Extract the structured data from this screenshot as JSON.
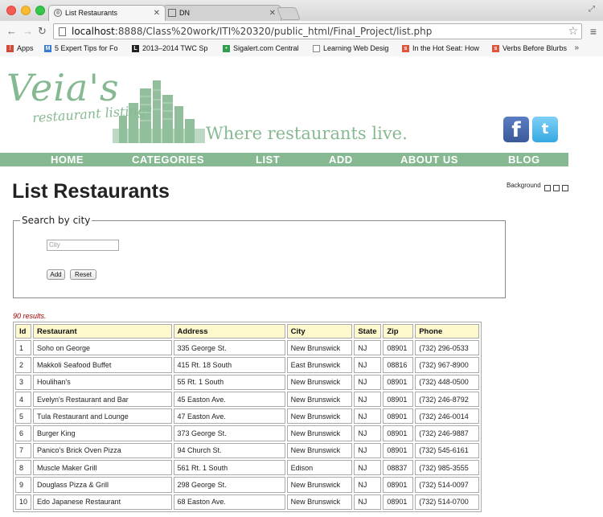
{
  "browser": {
    "tabs": [
      {
        "title": "List Restaurants",
        "active": true
      },
      {
        "title": "DN",
        "active": false
      }
    ],
    "url_host": "localhost",
    "url_rest": ":8888/Class%20work/ITI%20320/public_html/Final_Project/list.php",
    "bookmarks": [
      {
        "label": "Apps",
        "icon": "apps-grid-icon",
        "color": "#d44a3a"
      },
      {
        "label": "5 Expert Tips for Fo",
        "icon": "m-icon",
        "color": "#3a7bd5"
      },
      {
        "label": "2013–2014 TWC Sp",
        "icon": "l-icon",
        "color": "#222222"
      },
      {
        "label": "Sigalert.com Central",
        "icon": "traffic-icon",
        "color": "#2e9e4f"
      },
      {
        "label": "Learning Web Desig",
        "icon": "page-icon",
        "color": "#888888"
      },
      {
        "label": "In the Hot Seat: How",
        "icon": "bm-red-icon",
        "color": "#e0553b"
      },
      {
        "label": "Verbs Before Blurbs",
        "icon": "bm-red-icon",
        "color": "#e0553b"
      }
    ],
    "more": "»"
  },
  "site": {
    "logo": "Veia's",
    "logo_sub": "restaurant listings",
    "tagline": "Where restaurants live.",
    "nav": [
      "HOME",
      "CATEGORIES",
      "LIST",
      "ADD",
      "ABOUT US",
      "BLOG"
    ],
    "brand_color": "#86b992"
  },
  "page": {
    "title": "List Restaurants",
    "background_label": "Background",
    "search": {
      "legend": "Search by city",
      "placeholder": "City",
      "add_label": "Add",
      "reset_label": "Reset"
    },
    "results_text": "90 results."
  },
  "table": {
    "columns": [
      "Id",
      "Restaurant",
      "Address",
      "City",
      "State",
      "Zip",
      "Phone"
    ],
    "rows": [
      [
        "1",
        "Soho on George",
        "335 George St.",
        "New Brunswick",
        "NJ",
        "08901",
        "(732) 296-0533"
      ],
      [
        "2",
        "Makkoli Seafood Buffet",
        "415 Rt. 18 South",
        "East Brunswick",
        "NJ",
        "08816",
        "(732) 967-8900"
      ],
      [
        "3",
        "Houlihan's",
        "55 Rt. 1 South",
        "New Brunswick",
        "NJ",
        "08901",
        "(732) 448-0500"
      ],
      [
        "4",
        "Evelyn's Restaurant and Bar",
        "45 Easton Ave.",
        "New Brunswick",
        "NJ",
        "08901",
        "(732) 246-8792"
      ],
      [
        "5",
        "Tula Restaurant and Lounge",
        "47 Easton Ave.",
        "New Brunswick",
        "NJ",
        "08901",
        "(732) 246-0014"
      ],
      [
        "6",
        "Burger King",
        "373 George St.",
        "New Brunswick",
        "NJ",
        "08901",
        "(732) 246-9887"
      ],
      [
        "7",
        "Panico's Brick Oven Pizza",
        "94 Church St.",
        "New Brunswick",
        "NJ",
        "08901",
        "(732) 545-6161"
      ],
      [
        "8",
        "Muscle Maker Grill",
        "561 Rt. 1 South",
        "Edison",
        "NJ",
        "08837",
        "(732) 985-3555"
      ],
      [
        "9",
        "Douglass Pizza & Grill",
        "298 George St.",
        "New Brunswick",
        "NJ",
        "08901",
        "(732) 514-0097"
      ],
      [
        "10",
        "Edo Japanese Restaurant",
        "68 Easton Ave.",
        "New Brunswick",
        "NJ",
        "08901",
        "(732) 514-0700"
      ]
    ]
  }
}
